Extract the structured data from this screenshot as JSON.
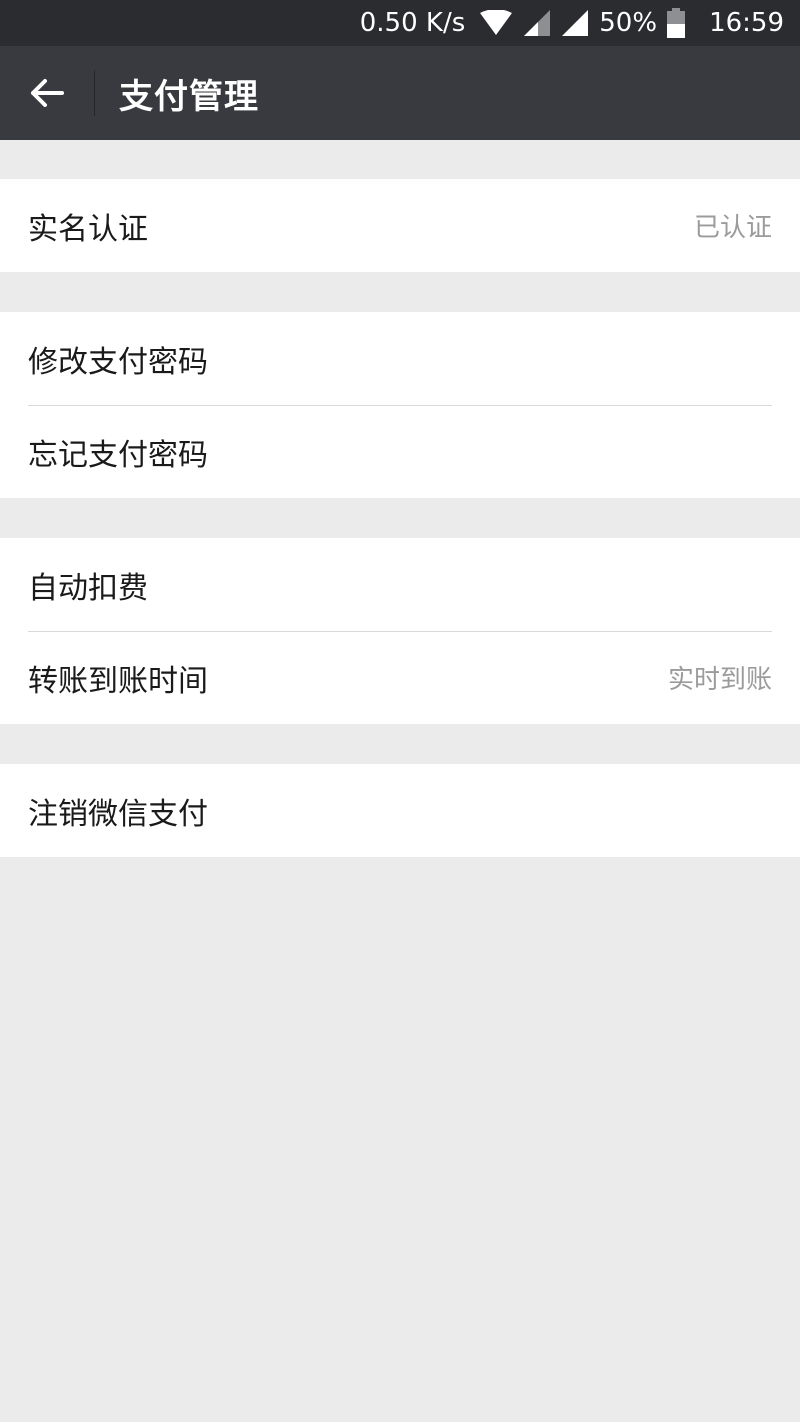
{
  "status_bar": {
    "network_speed": "0.50 K/s",
    "battery_percent": "50%",
    "time": "16:59",
    "icons": [
      "wifi-icon",
      "signal-icon",
      "signal-icon",
      "battery-icon"
    ]
  },
  "header": {
    "back_icon": "arrow-left-icon",
    "title": "支付管理"
  },
  "sections": {
    "identity": {
      "real_name_label": "实名认证",
      "real_name_value": "已认证"
    },
    "password": {
      "change_label": "修改支付密码",
      "forgot_label": "忘记支付密码"
    },
    "payments": {
      "auto_deduct_label": "自动扣费",
      "transfer_time_label": "转账到账时间",
      "transfer_time_value": "实时到账"
    },
    "account": {
      "close_label": "注销微信支付"
    }
  },
  "colors": {
    "status_bar_bg": "#2b2c30",
    "title_bar_bg": "#393a3f",
    "page_bg": "#ebebeb",
    "cell_bg": "#ffffff",
    "secondary_text": "#9b9b9b"
  }
}
